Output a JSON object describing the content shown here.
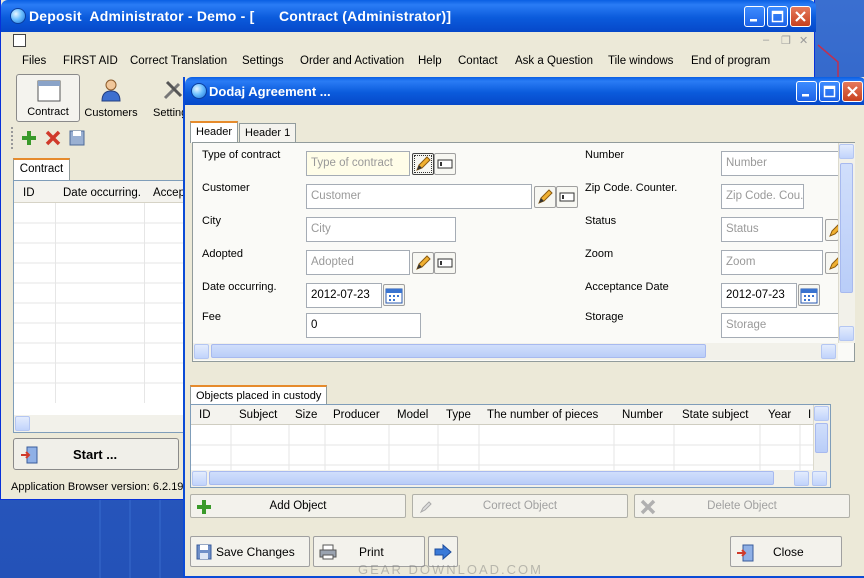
{
  "main_window": {
    "title": "Deposit  Administrator - Demo - [      Contract (Administrator)]"
  },
  "menu": {
    "items": [
      "Files",
      "FIRST AID",
      "Correct Translation",
      "Settings",
      "Order and Activation",
      "Help",
      "Contact",
      "Ask a Question",
      "Tile windows",
      "End of program"
    ]
  },
  "toolbar": {
    "contract_label": "Contract",
    "customers_label": "Customers",
    "settings_label": "Setting"
  },
  "left_panel": {
    "tab": "Contract",
    "columns": [
      "ID",
      "Date occurring.",
      "Accep"
    ],
    "start_label": "Start ...",
    "status": "Application Browser version: 6.2.19"
  },
  "dialog": {
    "title": "Dodaj Agreement ...",
    "tabs": [
      "Header",
      "Header 1"
    ],
    "fields": {
      "type_of_contract": {
        "label": "Type of contract",
        "placeholder": "Type of contract"
      },
      "customer": {
        "label": "Customer",
        "placeholder": "Customer"
      },
      "city": {
        "label": "City",
        "placeholder": "City"
      },
      "adopted": {
        "label": "Adopted",
        "placeholder": "Adopted"
      },
      "date_occurring": {
        "label": "Date occurring.",
        "value": "2012-07-23"
      },
      "fee": {
        "label": "Fee",
        "value": "0"
      },
      "number": {
        "label": "Number",
        "placeholder": "Number"
      },
      "zip_code": {
        "label": "Zip Code. Counter.",
        "placeholder": "Zip Code. Cou..."
      },
      "status": {
        "label": "Status",
        "placeholder": "Status"
      },
      "zoom": {
        "label": "Zoom",
        "placeholder": "Zoom"
      },
      "acceptance_date": {
        "label": "Acceptance Date",
        "value": "2012-07-23"
      },
      "storage": {
        "label": "Storage",
        "placeholder": "Storage"
      }
    },
    "objects_tab": "Objects placed in custody",
    "objects_columns": [
      "ID",
      "Subject",
      "Size",
      "Producer",
      "Model",
      "Type",
      "The number of pieces",
      "Number",
      "State subject",
      "Year",
      "I"
    ],
    "buttons": {
      "add_object": "Add Object",
      "correct_object": "Correct Object",
      "delete_object": "Delete Object",
      "save_changes": "Save Changes",
      "print": "Print",
      "close": "Close"
    }
  },
  "watermark": "GEAR DOWNLOAD.COM",
  "colors": {
    "titlebar": "#0b5bdc",
    "desktop": "#2c5fc4",
    "tab_accent": "#e68b2c",
    "close_button": "#c8401e"
  }
}
